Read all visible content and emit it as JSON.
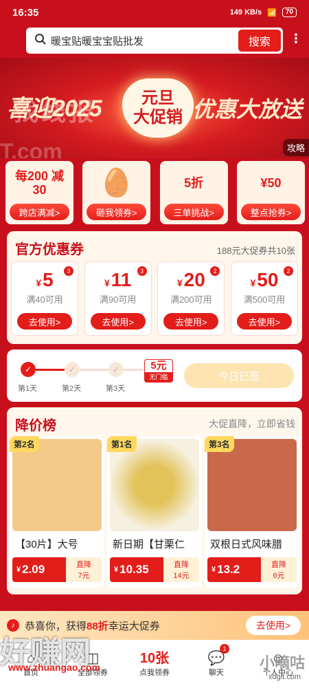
{
  "status": {
    "time": "16:35",
    "net": "149 KB/s",
    "battery": "70"
  },
  "search": {
    "query": "暖宝贴暖宝宝贴批发",
    "button": "搜索"
  },
  "banner": {
    "left": "喜迎2025",
    "heart_1": "元旦",
    "heart_2": "大促销",
    "right": "优惠大放送",
    "guide": "攻略",
    "watermark_1": "找线报",
    "watermark_2": "T.com"
  },
  "tiles": [
    {
      "art": "每200 减30",
      "label": "跨店满减>"
    },
    {
      "art": "🥚",
      "label": "砸我领券>"
    },
    {
      "art": "5折",
      "label": "三单挑战>"
    },
    {
      "art": "¥50",
      "label": "整点抢券>"
    }
  ],
  "coupons": {
    "title": "官方优惠券",
    "subtitle": "188元大促券共10张",
    "items": [
      {
        "amount": "5",
        "cond": "满40可用",
        "badge": "3",
        "button": "去使用>"
      },
      {
        "amount": "11",
        "cond": "满90可用",
        "badge": "3",
        "button": "去使用>"
      },
      {
        "amount": "20",
        "cond": "满200可用",
        "badge": "2",
        "button": "去使用>"
      },
      {
        "amount": "50",
        "cond": "满500可用",
        "badge": "2",
        "button": "去使用>"
      }
    ]
  },
  "checkin": {
    "days": [
      "第1天",
      "第2天",
      "第3天"
    ],
    "reward": "5元",
    "reward_sub": "无门槛",
    "button": "今日已签"
  },
  "drops": {
    "title": "降价榜",
    "subtitle": "大促直降，立即省钱",
    "items": [
      {
        "rank": "第2名",
        "title": "【30片】大号",
        "price": "2.09",
        "drop_label": "直降",
        "drop": "7元",
        "img_color": "#f3c98a"
      },
      {
        "rank": "第1名",
        "title": "新日期【甘栗仁",
        "price": "10.35",
        "drop_label": "直降",
        "drop": "14元",
        "img_color": "#d8b24a"
      },
      {
        "rank": "第3名",
        "title": "双根日式风味腊",
        "price": "13.2",
        "drop_label": "直降",
        "drop": "6元",
        "img_color": "#c86a4a"
      }
    ]
  },
  "toast": {
    "pre": "恭喜你，获得",
    "highlight": "88折",
    "post": "幸运大促券",
    "button": "去使用>"
  },
  "tabbar": [
    {
      "icon": "⌂",
      "label": "首页"
    },
    {
      "icon": "◫",
      "label": "全部领券"
    },
    {
      "icon": "10张",
      "label": "点我领券"
    },
    {
      "icon": "💬",
      "label": "聊天",
      "badge": "1"
    },
    {
      "icon": "☺",
      "label": "个人中心"
    }
  ],
  "watermarks": {
    "bottom_left": "好赚网",
    "bottom_left_url": "www.zhuangao.com",
    "bottom_right": "小嘀咕",
    "bottom_right_url": "xdgit.com"
  }
}
